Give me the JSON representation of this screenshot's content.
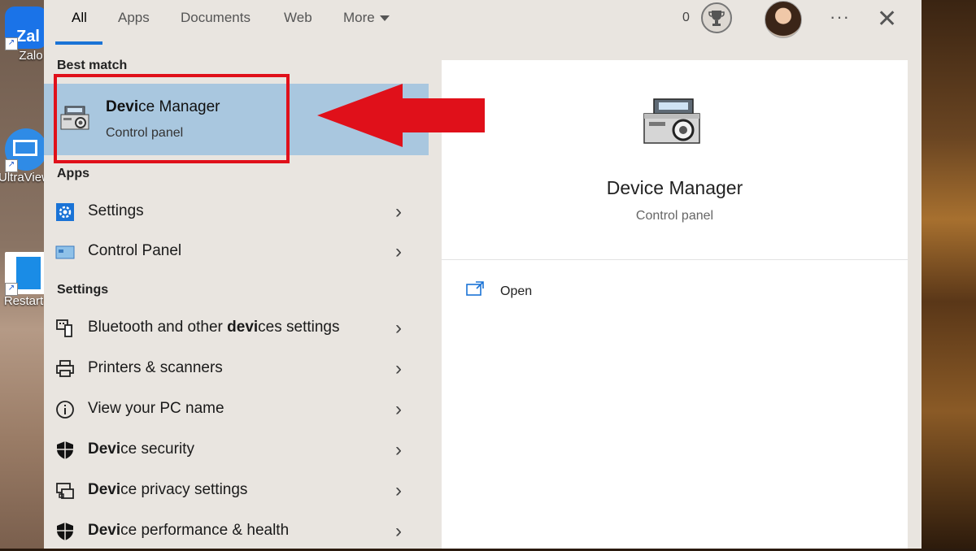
{
  "tabs": [
    "All",
    "Apps",
    "Documents",
    "Web",
    "More"
  ],
  "points": "0",
  "desktop_icons": [
    "Zalo",
    "UltraView",
    "Restart"
  ],
  "desktop_icon_badges": {
    "zalo": "Zal"
  },
  "best_match": {
    "heading": "Best match",
    "title_bold": "Devi",
    "title_rest": "ce Manager",
    "subtitle": "Control panel"
  },
  "apps": {
    "heading": "Apps",
    "items": [
      {
        "label": "Settings",
        "icon": "gear-icon"
      },
      {
        "label": "Control Panel",
        "icon": "control-panel-icon"
      }
    ]
  },
  "settings": {
    "heading": "Settings",
    "items": [
      {
        "pre": "Bluetooth and other ",
        "bold": "devi",
        "post": "ces settings",
        "icon": "bluetooth-devices-icon"
      },
      {
        "pre": "Printers & scanners",
        "bold": "",
        "post": "",
        "icon": "printer-icon"
      },
      {
        "pre": "View your PC name",
        "bold": "",
        "post": "",
        "icon": "info-icon"
      },
      {
        "pre": "",
        "bold": "Devi",
        "post": "ce security",
        "icon": "shield-icon"
      },
      {
        "pre": "",
        "bold": "Devi",
        "post": "ce privacy settings",
        "icon": "privacy-icon"
      },
      {
        "pre": "",
        "bold": "Devi",
        "post": "ce performance & health",
        "icon": "shield-icon"
      }
    ]
  },
  "detail": {
    "title": "Device Manager",
    "subtitle": "Control panel",
    "open_label": "Open"
  },
  "colors": {
    "highlight": "#a9c7df",
    "accent": "#1a73d6",
    "annotation_red": "#e0101a"
  }
}
